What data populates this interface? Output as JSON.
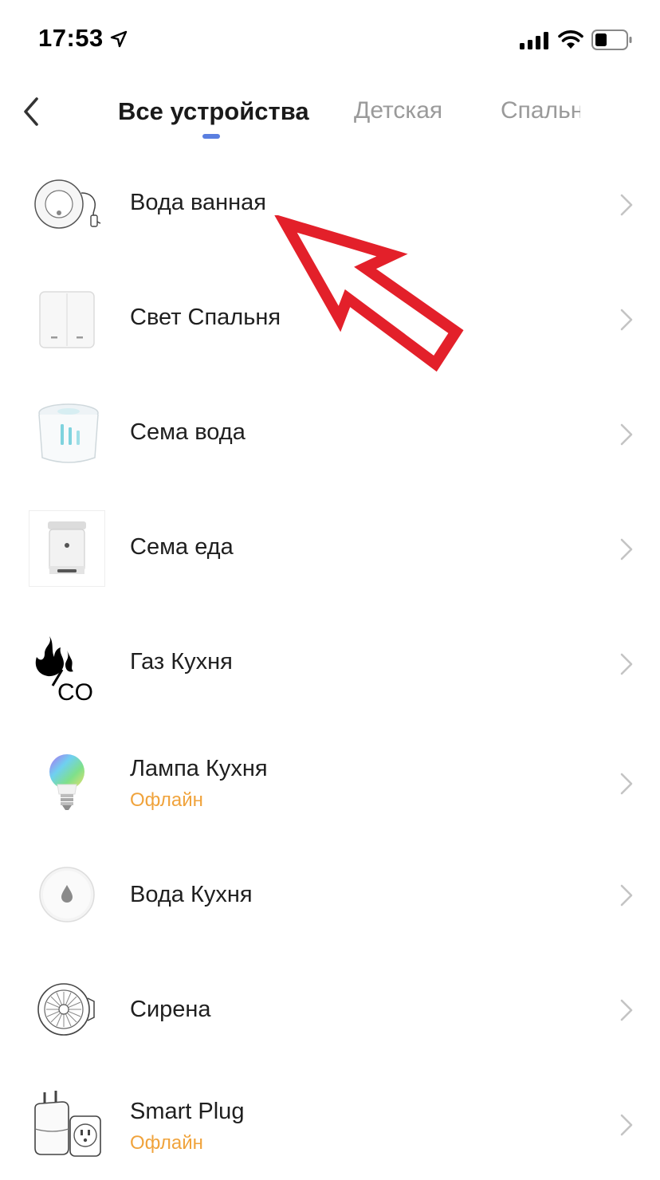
{
  "status_bar": {
    "time": "17:53",
    "location_icon": "location-arrow-icon",
    "signal_icon": "cellular-signal-icon",
    "wifi_icon": "wifi-icon",
    "battery_icon": "battery-icon"
  },
  "nav": {
    "back_icon": "chevron-left-icon",
    "tabs": [
      {
        "label": "Все устройства",
        "active": true
      },
      {
        "label": "Детская",
        "active": false
      },
      {
        "label": "Спальн",
        "active": false
      }
    ]
  },
  "devices": [
    {
      "name": "Вода ванная",
      "status": "",
      "icon": "water-leak-sensor-icon"
    },
    {
      "name": "Свет Спальня",
      "status": "",
      "icon": "wall-switch-icon"
    },
    {
      "name": "Сема вода",
      "status": "",
      "icon": "pet-water-fountain-icon"
    },
    {
      "name": "Сема еда",
      "status": "",
      "icon": "pet-feeder-icon"
    },
    {
      "name": "Газ Кухня",
      "status": "",
      "icon": "gas-co-detector-icon"
    },
    {
      "name": "Лампа Кухня",
      "status": "Офлайн",
      "icon": "rgb-bulb-icon"
    },
    {
      "name": "Вода Кухня",
      "status": "",
      "icon": "water-drop-sensor-icon"
    },
    {
      "name": "Сирена",
      "status": "",
      "icon": "siren-icon"
    },
    {
      "name": "Smart Plug",
      "status": "Офлайн",
      "icon": "smart-plug-icon"
    }
  ],
  "colors": {
    "accent": "#5a7fe0",
    "offline": "#f0a33c",
    "annotation_arrow": "#e3202a"
  }
}
